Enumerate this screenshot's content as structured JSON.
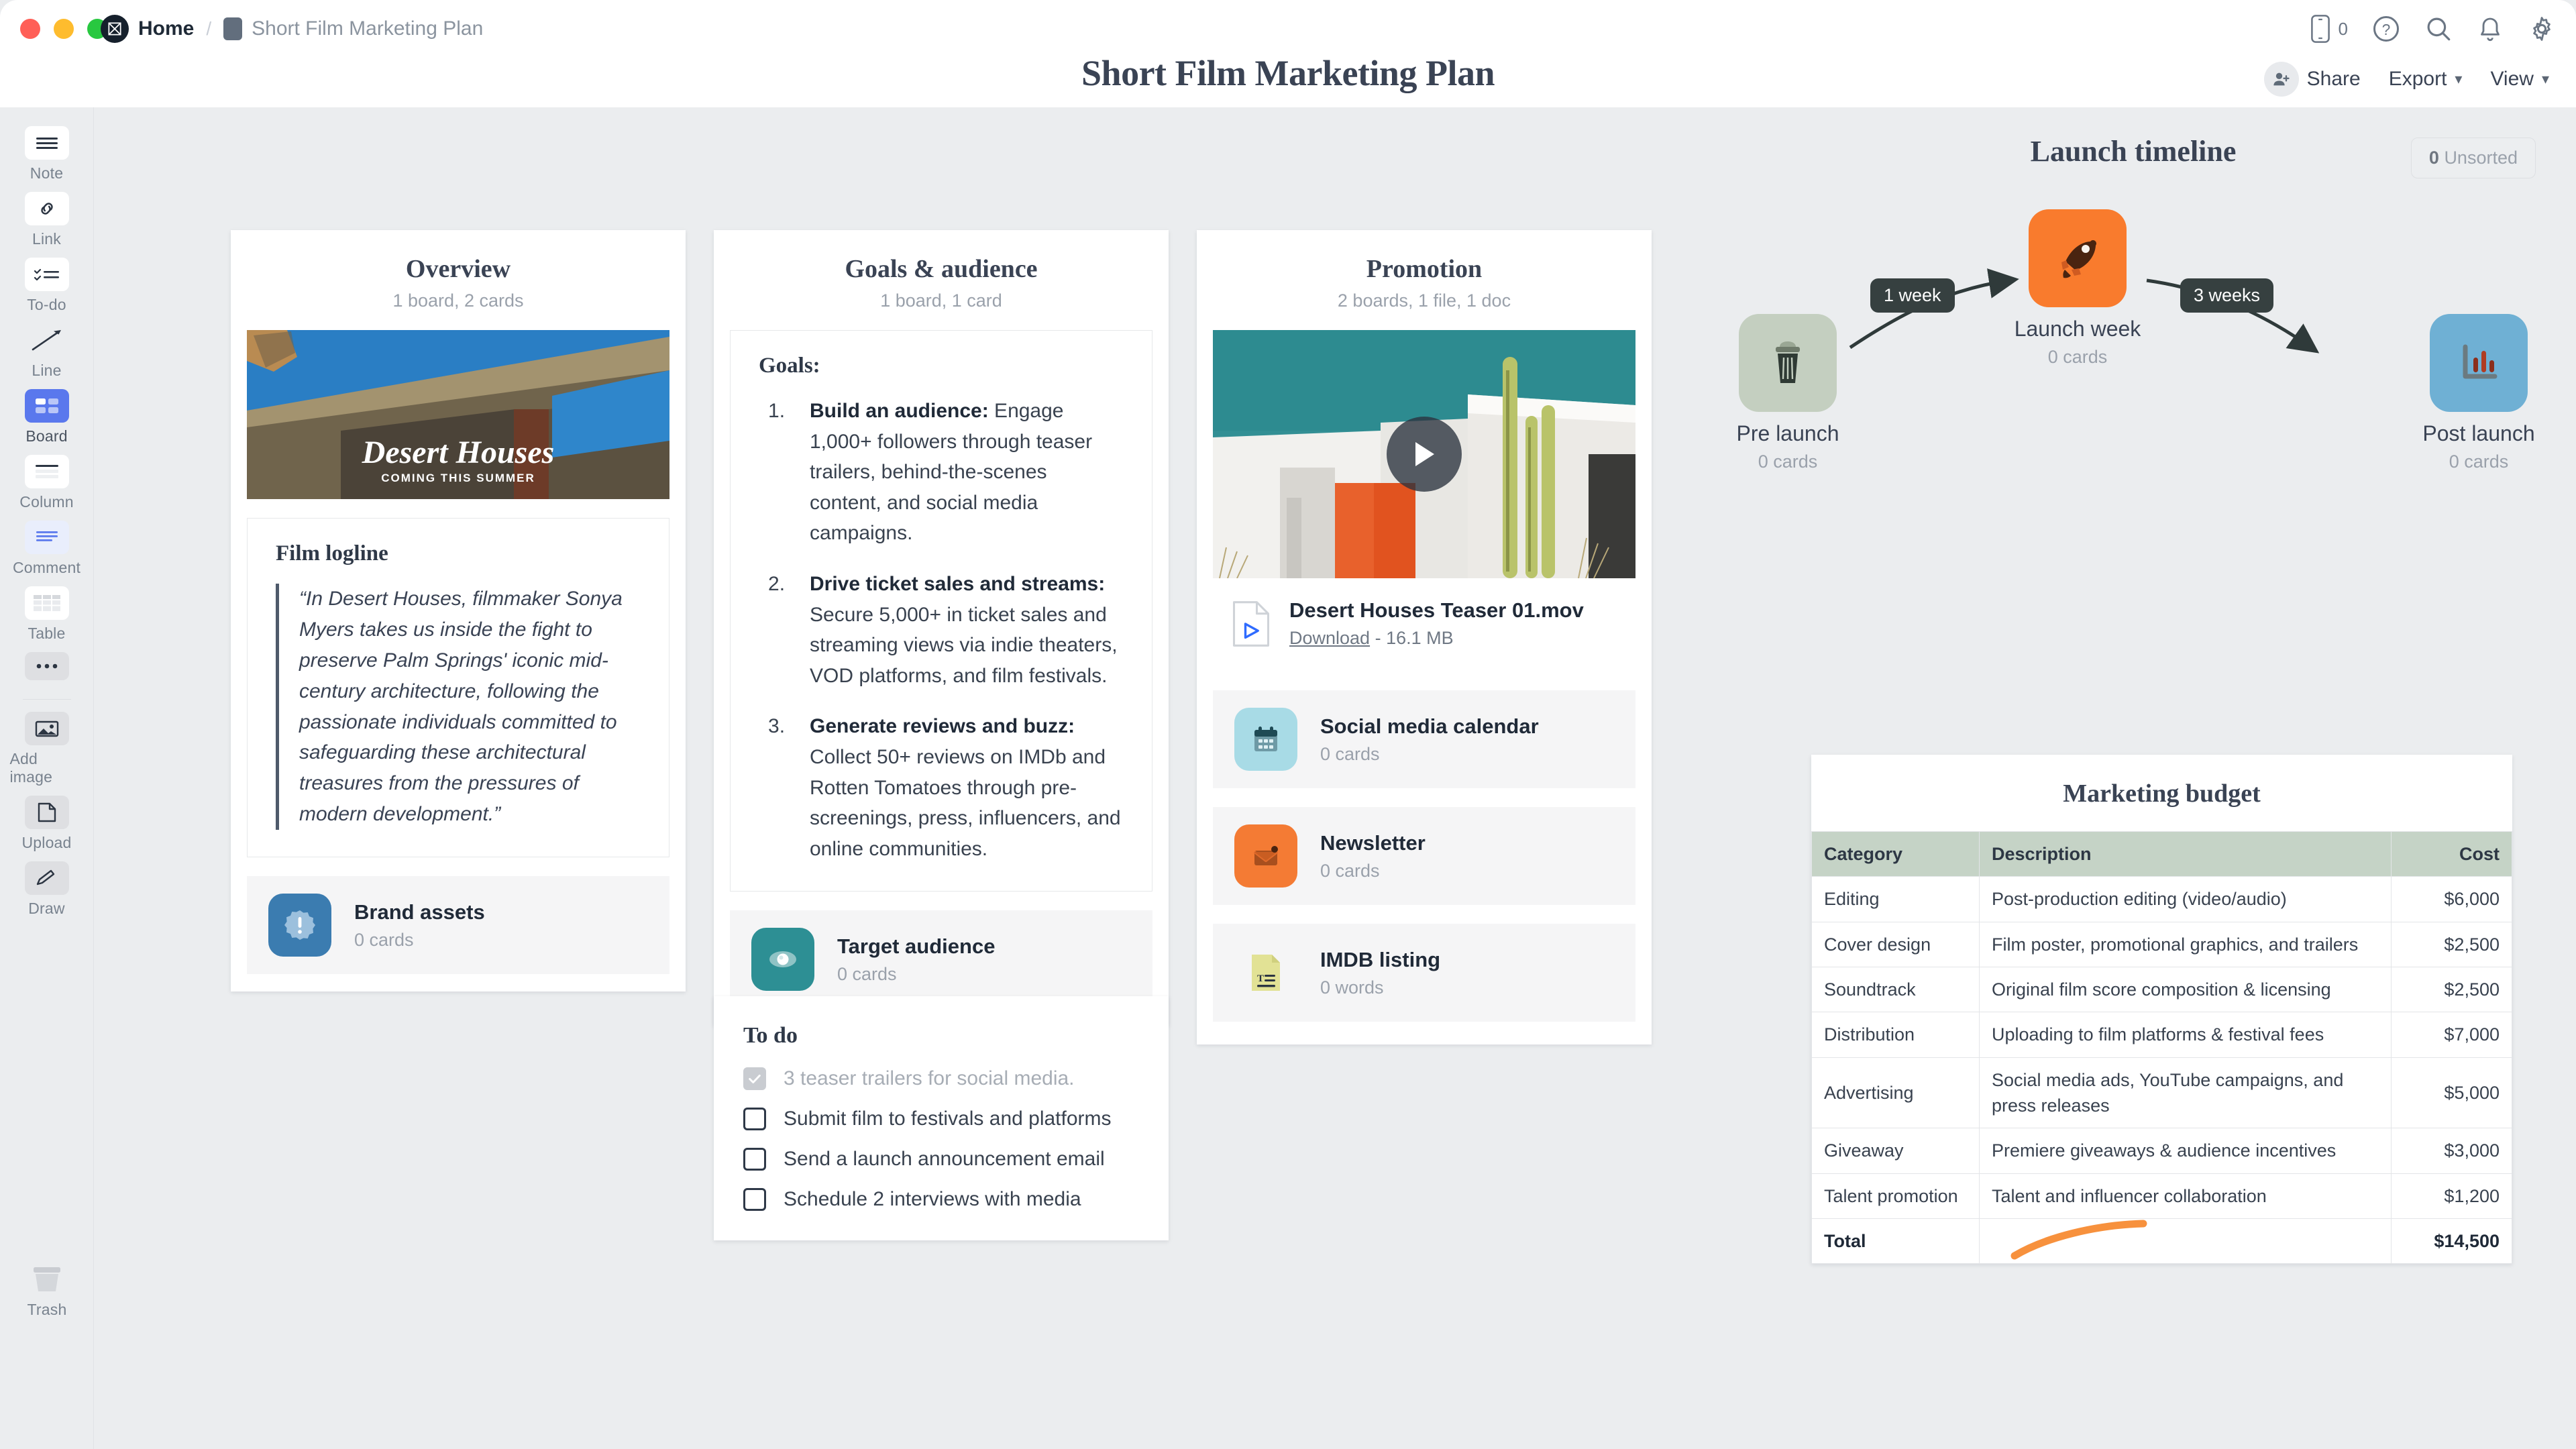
{
  "window": {
    "breadcrumb": {
      "logo": "M",
      "home": "Home",
      "separator": "/",
      "doc": "Short Film Marketing Plan"
    },
    "title": "Short Film Marketing Plan",
    "top_icons": [
      {
        "name": "mobile-icon",
        "count": "0"
      },
      {
        "name": "help-icon"
      },
      {
        "name": "search-icon"
      },
      {
        "name": "notifications-icon"
      },
      {
        "name": "settings-icon"
      }
    ],
    "actions": {
      "share": "Share",
      "export": "Export",
      "view": "View"
    }
  },
  "sidebar": {
    "tools": [
      {
        "label": "Note",
        "icon": "note-icon",
        "state": "white"
      },
      {
        "label": "Link",
        "icon": "link-icon",
        "state": "white"
      },
      {
        "label": "To-do",
        "icon": "todo-icon",
        "state": "white"
      },
      {
        "label": "Line",
        "icon": "line-icon",
        "state": "flat"
      },
      {
        "label": "Board",
        "icon": "board-icon",
        "state": "active"
      },
      {
        "label": "Column",
        "icon": "column-icon",
        "state": "white"
      },
      {
        "label": "Comment",
        "icon": "comment-icon",
        "state": "white"
      },
      {
        "label": "Table",
        "icon": "table-icon",
        "state": "white"
      },
      {
        "label": "",
        "icon": "more-icon",
        "state": "grey"
      }
    ],
    "tools_lower": [
      {
        "label": "Add image",
        "icon": "image-icon",
        "state": "grey"
      },
      {
        "label": "Upload",
        "icon": "upload-icon",
        "state": "grey"
      },
      {
        "label": "Draw",
        "icon": "draw-icon",
        "state": "grey"
      }
    ],
    "trash": {
      "label": "Trash",
      "icon": "trash-icon"
    }
  },
  "canvas": {
    "unsorted_count": "0",
    "unsorted_label": "Unsorted"
  },
  "columns": {
    "overview": {
      "title": "Overview",
      "subtitle": "1 board, 2 cards",
      "poster": {
        "title": "Desert Houses",
        "tagline": "COMING THIS SUMMER"
      },
      "note_heading": "Film logline",
      "quote": "“In Desert Houses, filmmaker Sonya Myers takes us inside the fight to preserve Palm Springs' iconic mid-century architecture, following the passionate individuals committed to safeguarding these architectural treasures from the pressures of modern development.”",
      "board": {
        "name": "Brand assets",
        "sub": "0 cards",
        "icon": "badge-exclamation-icon",
        "color": "#3b7cb0"
      }
    },
    "goals": {
      "title": "Goals & audience",
      "subtitle": "1 board, 1 card",
      "note_heading": "Goals:",
      "items": [
        {
          "bold": "Build an audience:",
          "rest": " Engage 1,000+ followers through teaser trailers, behind-the-scenes content, and social media campaigns."
        },
        {
          "bold": "Drive ticket sales and streams:",
          "rest": " Secure 5,000+ in ticket sales and streaming views via indie theaters, VOD platforms, and film festivals."
        },
        {
          "bold": "Generate reviews and buzz:",
          "rest": " Collect 50+ reviews on IMDb and Rotten Tomatoes through pre-screenings, press, influencers, and online communities."
        }
      ],
      "board": {
        "name": "Target audience",
        "sub": "0 cards",
        "icon": "eye-icon",
        "color": "#2d8f94"
      }
    },
    "promotion": {
      "title": "Promotion",
      "subtitle": "2 boards, 1 file, 1 doc",
      "file": {
        "name": "Desert Houses Teaser 01.mov",
        "download": "Download",
        "size": "- 16.1 MB",
        "icon": "video-file-icon"
      },
      "boards": [
        {
          "name": "Social media calendar",
          "sub": "0 cards",
          "icon": "calendar-icon",
          "color": "#a8dbe6"
        },
        {
          "name": "Newsletter",
          "sub": "0 cards",
          "icon": "envelope-icon",
          "color": "#f47b34"
        },
        {
          "name": "IMDB listing",
          "sub": "0 words",
          "icon": "document-icon",
          "color": "#e2e295"
        }
      ]
    }
  },
  "todo": {
    "heading": "To do",
    "items": [
      {
        "label": "3 teaser trailers for social media.",
        "done": true
      },
      {
        "label": "Submit film to festivals and platforms",
        "done": false
      },
      {
        "label": "Send a launch announcement email",
        "done": false
      },
      {
        "label": "Schedule 2 interviews with media",
        "done": false
      }
    ]
  },
  "timeline": {
    "title": "Launch timeline",
    "nodes": [
      {
        "name": "Pre launch",
        "sub": "0 cards",
        "icon": "trash-can-icon",
        "color": "#c4cfc0"
      },
      {
        "name": "Launch week",
        "sub": "0 cards",
        "icon": "rocket-icon",
        "color": "#f97b2d"
      },
      {
        "name": "Post launch",
        "sub": "0 cards",
        "icon": "bar-chart-icon",
        "color": "#6fb0d4"
      }
    ],
    "edges": [
      {
        "label": "1 week"
      },
      {
        "label": "3 weeks"
      }
    ]
  },
  "budget": {
    "title": "Marketing budget",
    "columns": [
      "Category",
      "Description",
      "Cost"
    ],
    "rows": [
      {
        "category": "Editing",
        "description": "Post-production editing (video/audio)",
        "cost": "$6,000"
      },
      {
        "category": "Cover design",
        "description": "Film poster, promotional graphics, and trailers",
        "cost": "$2,500"
      },
      {
        "category": "Soundtrack",
        "description": "Original film score composition & licensing",
        "cost": "$2,500"
      },
      {
        "category": "Distribution",
        "description": "Uploading to film platforms & festival fees",
        "cost": "$7,000"
      },
      {
        "category": "Advertising",
        "description": "Social media ads, YouTube campaigns, and press releases",
        "cost": "$5,000"
      },
      {
        "category": "Giveaway",
        "description": "Premiere giveaways & audience incentives",
        "cost": "$3,000"
      },
      {
        "category": "Talent promotion",
        "description": "Talent and influencer collaboration",
        "cost": "$1,200"
      }
    ],
    "total": {
      "label": "Total",
      "description": "",
      "cost": "$14,500"
    },
    "header_color": "#c5d3c6",
    "annotation_color": "#f7913d"
  }
}
